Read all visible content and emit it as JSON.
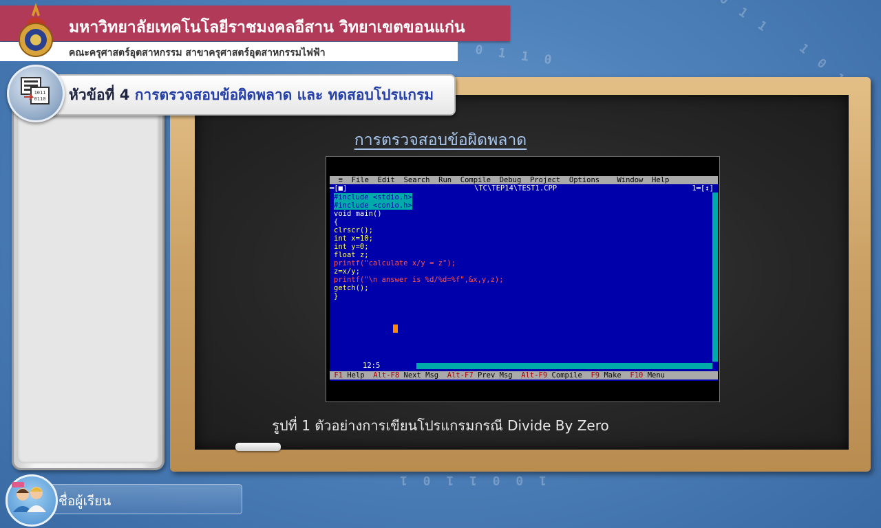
{
  "header": {
    "university": "มหาวิทยาลัยเทคโนโลยีราชมงคลอีสาน วิทยาเขตขอนแก่น",
    "faculty": "คณะครุศาสตร์อุตสาหกรรม สาขาครุศาสตร์อุตสาหกรรมไฟฟ้า"
  },
  "topic": {
    "prefix": "หัวข้อที่ 4 ",
    "title": "การตรวจสอบข้อผิดพลาด และ ทดสอบโปรแกรม"
  },
  "board": {
    "title": "การตรวจสอบข้อผิดพลาด",
    "caption": "รูปที่ 1 ตัวอย่างการเขียนโปรแกรมกรณี Divide By Zero"
  },
  "ide": {
    "menu": [
      "≡",
      "File",
      "Edit",
      "Search",
      "Run",
      "Compile",
      "Debug",
      "Project",
      "Options",
      "Window",
      "Help"
    ],
    "window_left": "═[■]",
    "file_path": "\\TC\\TEP14\\TEST1.CPP",
    "window_right": "1═[↕]",
    "code": [
      "#include <stdio.h>",
      "#include <conio.h>",
      "void main()",
      "{",
      "clrscr();",
      "int x=10;",
      "int y=0;",
      "float z;",
      "printf(\"calculate x/y = z\");",
      "z=x/y;",
      "printf(\"\\n answer is %d/%d=%f\",&x,y,z);",
      "getch();",
      "}"
    ],
    "cursor_pos": "12:5",
    "hints": [
      {
        "key": "F1",
        "label": "Help"
      },
      {
        "key": "Alt-F8",
        "label": "Next Msg"
      },
      {
        "key": "Alt-F7",
        "label": "Prev Msg"
      },
      {
        "key": "Alt-F9",
        "label": "Compile"
      },
      {
        "key": "F9",
        "label": "Make"
      },
      {
        "key": "F10",
        "label": "Menu"
      }
    ]
  },
  "student": {
    "label": "ชื่อผู้เรียน"
  },
  "background_digits": [
    "0 1 1",
    "1 0 1 0",
    "0 1 1 0",
    "1 0 0 1 1 0 1"
  ]
}
